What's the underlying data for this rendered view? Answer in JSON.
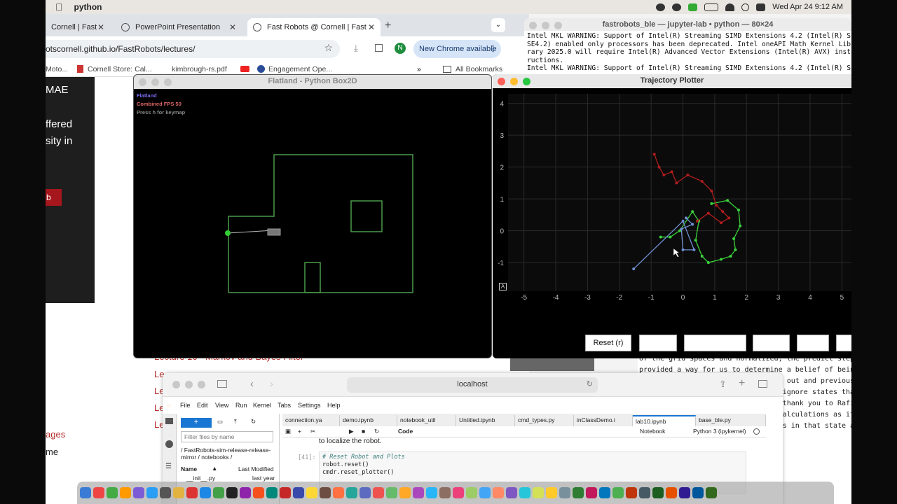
{
  "menubar": {
    "app_name": "python",
    "datetime": "Wed Apr 24  9:12 AM"
  },
  "chrome": {
    "tabs": [
      {
        "label": "Cornell | Fast"
      },
      {
        "label": "PowerPoint Presentation"
      },
      {
        "label": "Fast Robots @ Cornell | Fast"
      }
    ],
    "url": "otscornell.github.io/FastRobots/lectures/",
    "new_chrome": "New Chrome available",
    "profile": "N",
    "bookmarks": [
      "Moto...",
      "Cornell Store: Cal...",
      "kimbrough-rs.pdf",
      "Engagement Ope...",
      "All Bookmarks"
    ]
  },
  "page": {
    "panel_lines": [
      "MAE",
      "ffered",
      "sity in"
    ],
    "button": "b",
    "links": [
      "Lecture 16 - Markov and Bayes Filter",
      "Le",
      "Le",
      "Le",
      "Le"
    ],
    "left_links": [
      "ages",
      "me"
    ]
  },
  "terminal": {
    "title": "fastrobots_ble — jupyter-lab • python — 80×24",
    "text": "Intel MKL WARNING: Support of Intel(R) Streaming SIMD Extensions 4.2 (Intel(R) S\nSE4.2) enabled only processors has been deprecated. Intel oneAPI Math Kernel Lib\nrary 2025.0 will require Intel(R) Advanced Vector Extensions (Intel(R) AVX) inst\nructions.\nIntel MKL WARNING: Support of Intel(R) Streaming SIMD Extensions 4.2 (Intel(R) S",
    "lower_text": "of the grid spaces and normalized, the predict step f\nprovided a way for us to determine a belief of being \n                                   out and previous s\n                                  ignore states that\n                                  thank you to Rafi\n                                  alculations as it\n                                  s in that state an"
  },
  "flatland": {
    "title": "Flatland - Python Box2D",
    "hud": [
      "Flatland",
      "Combined FPS 50",
      "Press h for keymap"
    ]
  },
  "plotter": {
    "title": "Trajectory Plotter",
    "reset_label": "Reset (r)",
    "axis_badge": "A"
  },
  "chart_data": {
    "type": "line",
    "title": "",
    "xlabel": "",
    "ylabel": "",
    "xlim": [
      -5.5,
      5.3
    ],
    "ylim": [
      -1.9,
      4.3
    ],
    "xticks": [
      -5,
      -4,
      -3,
      -2,
      -1,
      0,
      1,
      2,
      3,
      4,
      5
    ],
    "yticks": [
      -1,
      0,
      1,
      2,
      3,
      4
    ],
    "grid": true,
    "series": [
      {
        "color": "#3bd13b",
        "x": [
          0.9,
          1.4,
          1.75,
          1.8,
          1.6,
          1.65,
          1.5,
          1.2,
          0.8,
          0.6,
          0.4,
          0.5,
          0.3,
          -0.1,
          -0.4,
          -0.7
        ],
        "y": [
          0.85,
          0.95,
          0.65,
          0.15,
          -0.25,
          -0.6,
          -0.8,
          -0.9,
          -1.0,
          -0.8,
          -0.3,
          0.3,
          0.6,
          0.0,
          -0.2,
          -0.2
        ]
      },
      {
        "color": "#b01d1d",
        "x": [
          -0.9,
          -0.75,
          -0.6,
          -0.35,
          -0.2,
          0.15,
          0.6,
          0.9,
          1.05,
          1.25,
          1.45,
          1.2,
          0.8,
          0.45
        ],
        "y": [
          2.4,
          2.0,
          1.75,
          1.85,
          1.5,
          1.75,
          1.55,
          1.25,
          0.8,
          0.6,
          0.4,
          0.25,
          0.55,
          0.3
        ]
      },
      {
        "color": "#6f8ecf",
        "x": [
          -1.55,
          0.0,
          0.35,
          0.0,
          -0.05,
          0.3,
          0.1
        ],
        "y": [
          -1.2,
          0.3,
          -0.6,
          -0.6,
          0.05,
          0.2,
          0.4
        ]
      }
    ]
  },
  "jupyter": {
    "url": "localhost",
    "menu": [
      "File",
      "Edit",
      "View",
      "Run",
      "Kernel",
      "Tabs",
      "Settings",
      "Help"
    ],
    "tabs": [
      "connection.ya",
      "demo.ipynb",
      "notebook_util",
      "Untitled.ipynb",
      "cmd_types.py",
      "inClassDemo.i",
      "lab10.ipynb",
      "base_ble.py"
    ],
    "toolbar_mode": "Code",
    "kernel": "Python 3 (ipykernel)",
    "notebook_label": "Notebook",
    "filter_placeholder": "Filter files by name",
    "breadcrumb": "/ FastRobots-sim-release-release-mirror / notebooks /",
    "col_name": "Name",
    "col_modified": "Last Modified",
    "file_row": "__init__.py",
    "file_time": "last year",
    "cell_prompt": "[41]:",
    "cell_lines": [
      "# Reset Robot and Plots",
      "robot.reset()",
      "cmdr.reset_plotter()"
    ],
    "above_text": "to localize the robot."
  }
}
